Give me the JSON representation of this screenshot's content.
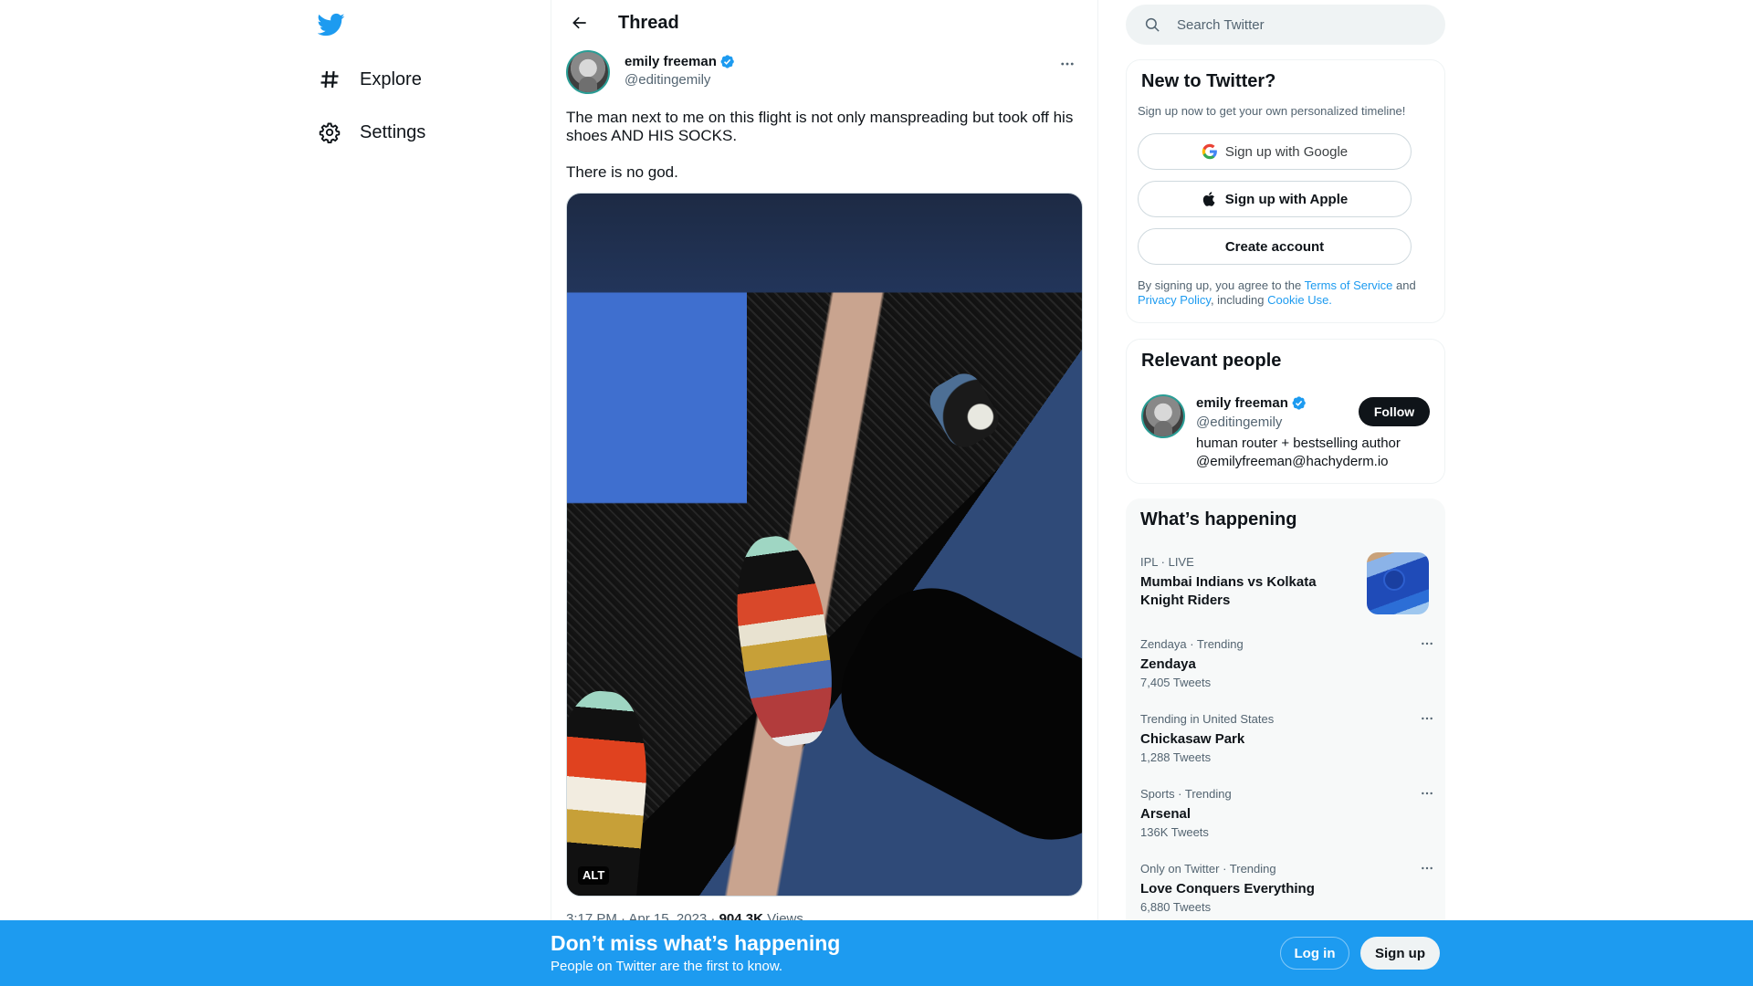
{
  "nav": {
    "logo": "twitter-bird-icon",
    "items": [
      {
        "label": "Explore",
        "icon": "hashtag-icon"
      },
      {
        "label": "Settings",
        "icon": "gear-icon"
      }
    ]
  },
  "thread": {
    "title": "Thread",
    "back_icon": "arrow-left-icon",
    "author": {
      "name": "emily freeman",
      "handle": "@editingemily",
      "verified": true
    },
    "text_paragraphs": [
      "The man next to me on this flight is not only manspreading but took off his shoes AND HIS SOCKS.",
      "There is no god."
    ],
    "media": {
      "alt_badge": "ALT"
    },
    "meta": {
      "time": "3:17 PM · Apr 15, 2023 · ",
      "views_count": "904.3K",
      "views_label": " Views"
    }
  },
  "search": {
    "placeholder": "Search Twitter"
  },
  "new_to_twitter": {
    "title": "New to Twitter?",
    "subtitle": "Sign up now to get your own personalized timeline!",
    "google_label": "Sign up with Google",
    "apple_label": "Sign up with Apple",
    "create_label": "Create account",
    "legal_prefix": "By signing up, you agree to the ",
    "terms_link": "Terms of Service",
    "legal_and": " and ",
    "privacy_link": "Privacy Policy",
    "legal_including": ", including ",
    "cookie_link": "Cookie Use."
  },
  "relevant_people": {
    "title": "Relevant people",
    "person": {
      "name": "emily freeman",
      "handle": "@editingemily",
      "bio_line1": "human router + bestselling author",
      "bio_line2": "@emilyfreeman@hachyderm.io",
      "follow_label": "Follow"
    }
  },
  "whats_happening": {
    "title": "What’s happening",
    "trends": [
      {
        "context": "IPL · LIVE",
        "name_line1": "Mumbai Indians vs Kolkata",
        "name_line2": "Knight Riders",
        "count": "",
        "has_thumbnail": true
      },
      {
        "context": "Zendaya · Trending",
        "name_line1": "Zendaya",
        "count": "7,405 Tweets"
      },
      {
        "context": "Trending in United States",
        "name_line1": "Chickasaw Park",
        "count": "1,288 Tweets"
      },
      {
        "context": "Sports · Trending",
        "name_line1": "Arsenal",
        "count": "136K Tweets"
      },
      {
        "context": "Only on Twitter · Trending",
        "name_line1": "Love Conquers Everything",
        "count": "6,880 Tweets"
      }
    ]
  },
  "banner": {
    "title": "Don’t miss what’s happening",
    "subtitle": "People on Twitter are the first to know.",
    "login_label": "Log in",
    "signup_label": "Sign up"
  },
  "colors": {
    "brand_blue": "#1d9bf0",
    "text_primary": "#0f1419",
    "text_secondary": "#536471"
  }
}
